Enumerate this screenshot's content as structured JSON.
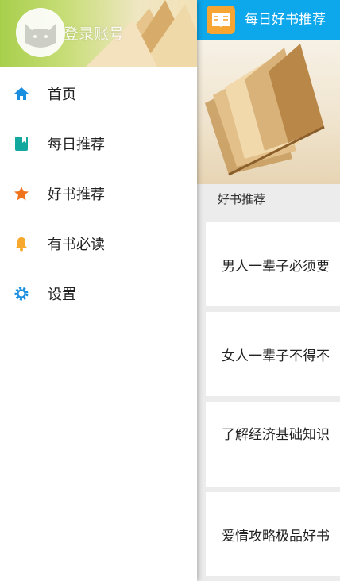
{
  "toolbar": {
    "title": "每日好书推荐",
    "icon": "book-icon",
    "color": "#0da7ec"
  },
  "section": {
    "title": "好书推荐"
  },
  "cards": [
    {
      "title": "男人一辈子必须要"
    },
    {
      "title": "女人一辈子不得不"
    },
    {
      "title": "了解经济基础知识"
    },
    {
      "title": "爱情攻略极品好书"
    }
  ],
  "drawer": {
    "login_label": "登录账号",
    "avatar_icon": "cat-avatar-icon",
    "menu": [
      {
        "label": "首页",
        "icon": "home-icon",
        "color": "#1a8fe0"
      },
      {
        "label": "每日推荐",
        "icon": "bookmark-book-icon",
        "color": "#13a89e"
      },
      {
        "label": "好书推荐",
        "icon": "star-icon",
        "color": "#f0731c"
      },
      {
        "label": "有书必读",
        "icon": "bell-icon",
        "color": "#f7a92e"
      },
      {
        "label": "设置",
        "icon": "gear-icon",
        "color": "#1a8fe0"
      }
    ]
  }
}
